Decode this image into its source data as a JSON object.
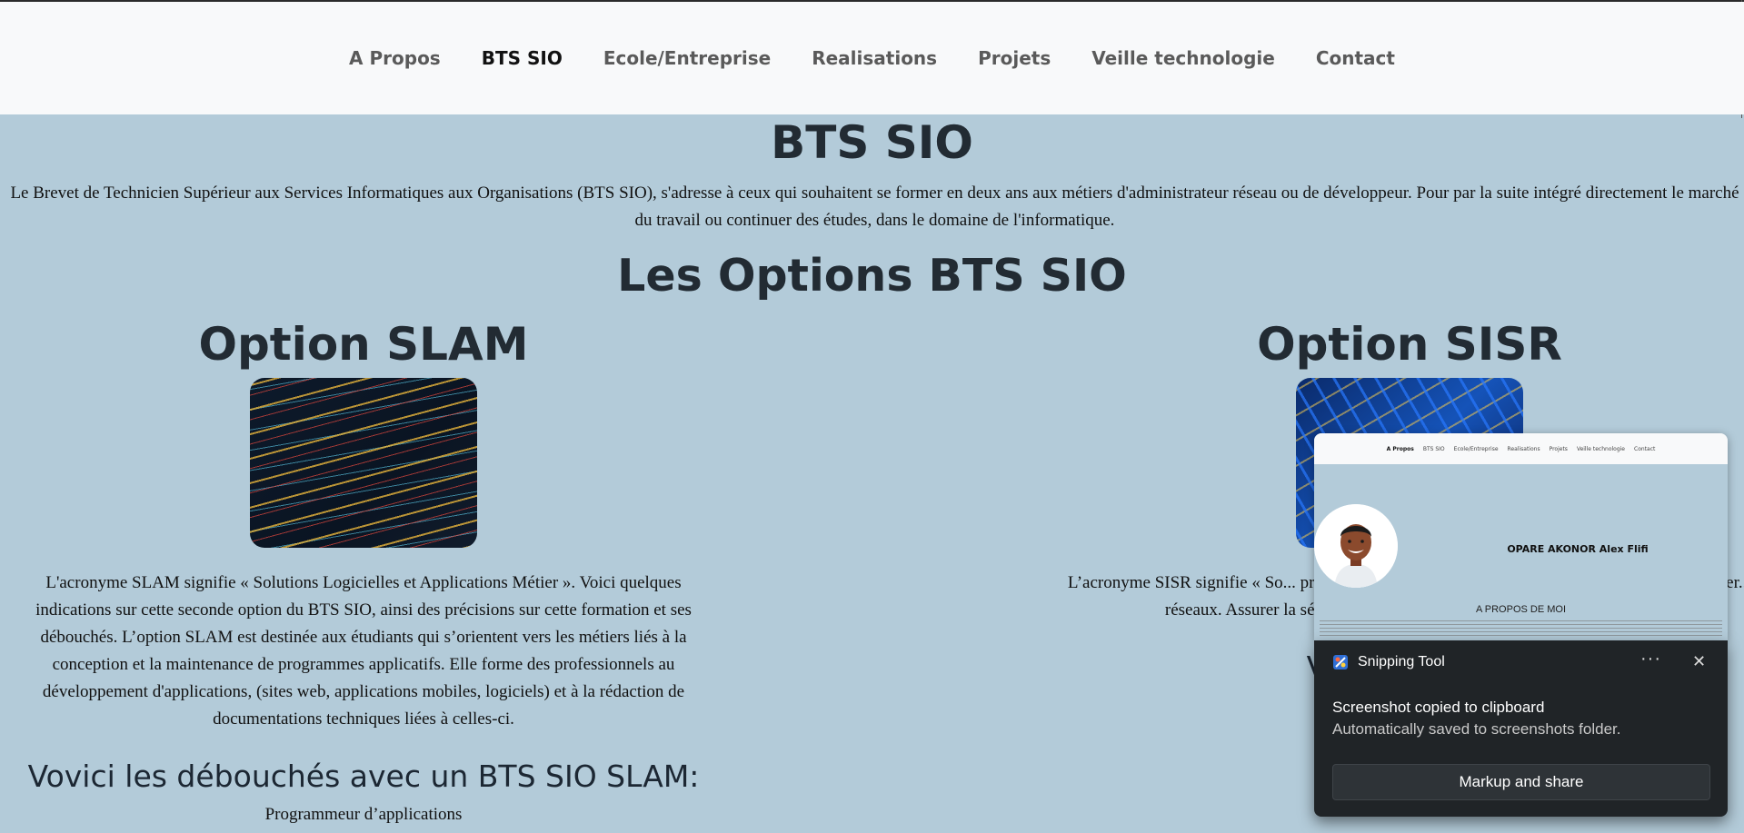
{
  "nav": {
    "items": [
      {
        "label": "A Propos"
      },
      {
        "label": "BTS SIO",
        "active": true
      },
      {
        "label": "Ecole/Entreprise"
      },
      {
        "label": "Realisations"
      },
      {
        "label": "Projets"
      },
      {
        "label": "Veille technologie"
      },
      {
        "label": "Contact"
      }
    ]
  },
  "page": {
    "title": "BTS SIO",
    "intro": "Le Brevet de Technicien Supérieur aux Services Informatiques aux Organisations (BTS SIO), s'adresse à ceux qui souhaitent se former en deux ans aux métiers d'administrateur réseau ou de développeur. Pour par la suite intégré directement le marché du travail ou continuer des études, dans le domaine de l'informatique.",
    "options_heading": "Les Options BTS SIO"
  },
  "slam": {
    "title": "Option SLAM",
    "image_icon": "code-screen-image",
    "description": "L'acronyme SLAM signifie « Solutions Logicielles et Applications Métier ». Voici quelques indications sur cette seconde option du BTS SIO, ainsi des précisions sur cette formation et ses débouchés. L’option SLAM est destinée aux étudiants qui s’orientent vers les métiers liés à la conception et la maintenance de programmes applicatifs. Elle forme des professionnels au développement d'applications, (sites web, applications mobiles, logiciels) et à la rédaction de documentations techniques liées à celles-ci.",
    "debouches_heading": "Vovici les débouchés avec un BTS SIO SLAM:",
    "first_job": "Programmeur d’applications"
  },
  "sisr": {
    "title": "Option SISR",
    "image_icon": "network-cables-image",
    "description": "L’acronyme SISR signifie « So... précisions sur cette formation e... qui s’orientent vers les métier... réseaux. Assurer la sécurité, la m... informatiques font partie des prin...",
    "debouches_heading": "Voici les débo"
  },
  "preview": {
    "nav": [
      "A Propos",
      "BTS SIO",
      "Ecole/Entreprise",
      "Realisations",
      "Projets",
      "Veille technologie",
      "Contact"
    ],
    "name": "OPARE AKONOR Alex Flifi",
    "section": "A PROPOS DE MOI"
  },
  "toast": {
    "app_name": "Snipping Tool",
    "more_label": "···",
    "close_label": "✕",
    "line1": "Screenshot copied to clipboard",
    "line2": "Automatically saved to screenshots folder.",
    "button": "Markup and share"
  }
}
